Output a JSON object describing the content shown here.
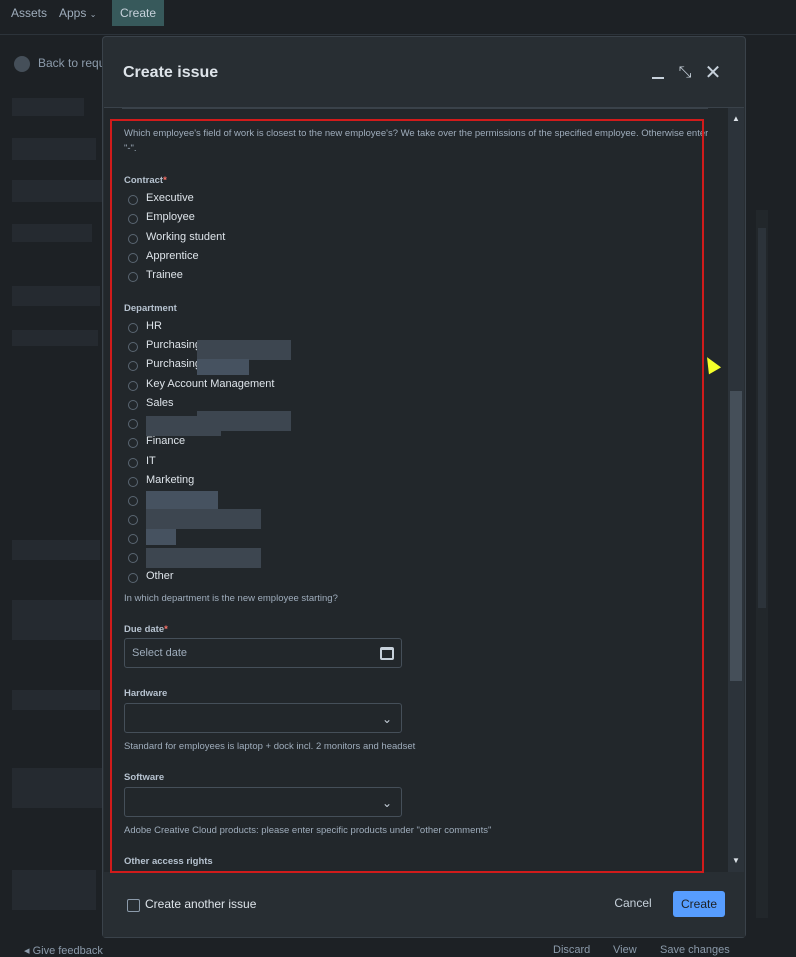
{
  "topbar": {
    "assets": "Assets",
    "apps": "Apps",
    "create": "Create"
  },
  "background": {
    "back_link": "Back to reque",
    "give_feedback": "Give feedback",
    "discard": "Discard",
    "view": "View",
    "save_changes": "Save changes"
  },
  "modal": {
    "title": "Create issue",
    "intro_hint": "Which employee's field of work is closest to the new employee's? We take over the permissions of the specified employee. Otherwise enter",
    "intro_hint_2": "\"-\".",
    "contract": {
      "label": "Contract",
      "required": "*",
      "options": [
        "Executive",
        "Employee",
        "Working student",
        "Apprentice",
        "Trainee"
      ]
    },
    "department": {
      "label": "Department",
      "options": [
        "HR",
        "Purchasing",
        "Purchasing",
        "Key Account Management",
        "Sales",
        "",
        "Finance",
        "IT",
        "Marketing",
        "",
        "",
        "",
        "",
        "Other"
      ],
      "hint": "In which department is the new employee starting?"
    },
    "due_date": {
      "label": "Due date",
      "required": "*",
      "placeholder": "Select date"
    },
    "hardware": {
      "label": "Hardware",
      "hint": "Standard for employees is laptop + dock incl. 2 monitors and headset"
    },
    "software": {
      "label": "Software",
      "hint": "Adobe Creative Cloud products: please enter specific products under \"other comments\""
    },
    "other_access": {
      "label": "Other access rights"
    },
    "footer": {
      "create_another": "Create another issue",
      "cancel": "Cancel",
      "create": "Create"
    }
  },
  "colors": {
    "accent": "#579dff",
    "highlight": "#d11b1b",
    "required": "#f87168"
  }
}
